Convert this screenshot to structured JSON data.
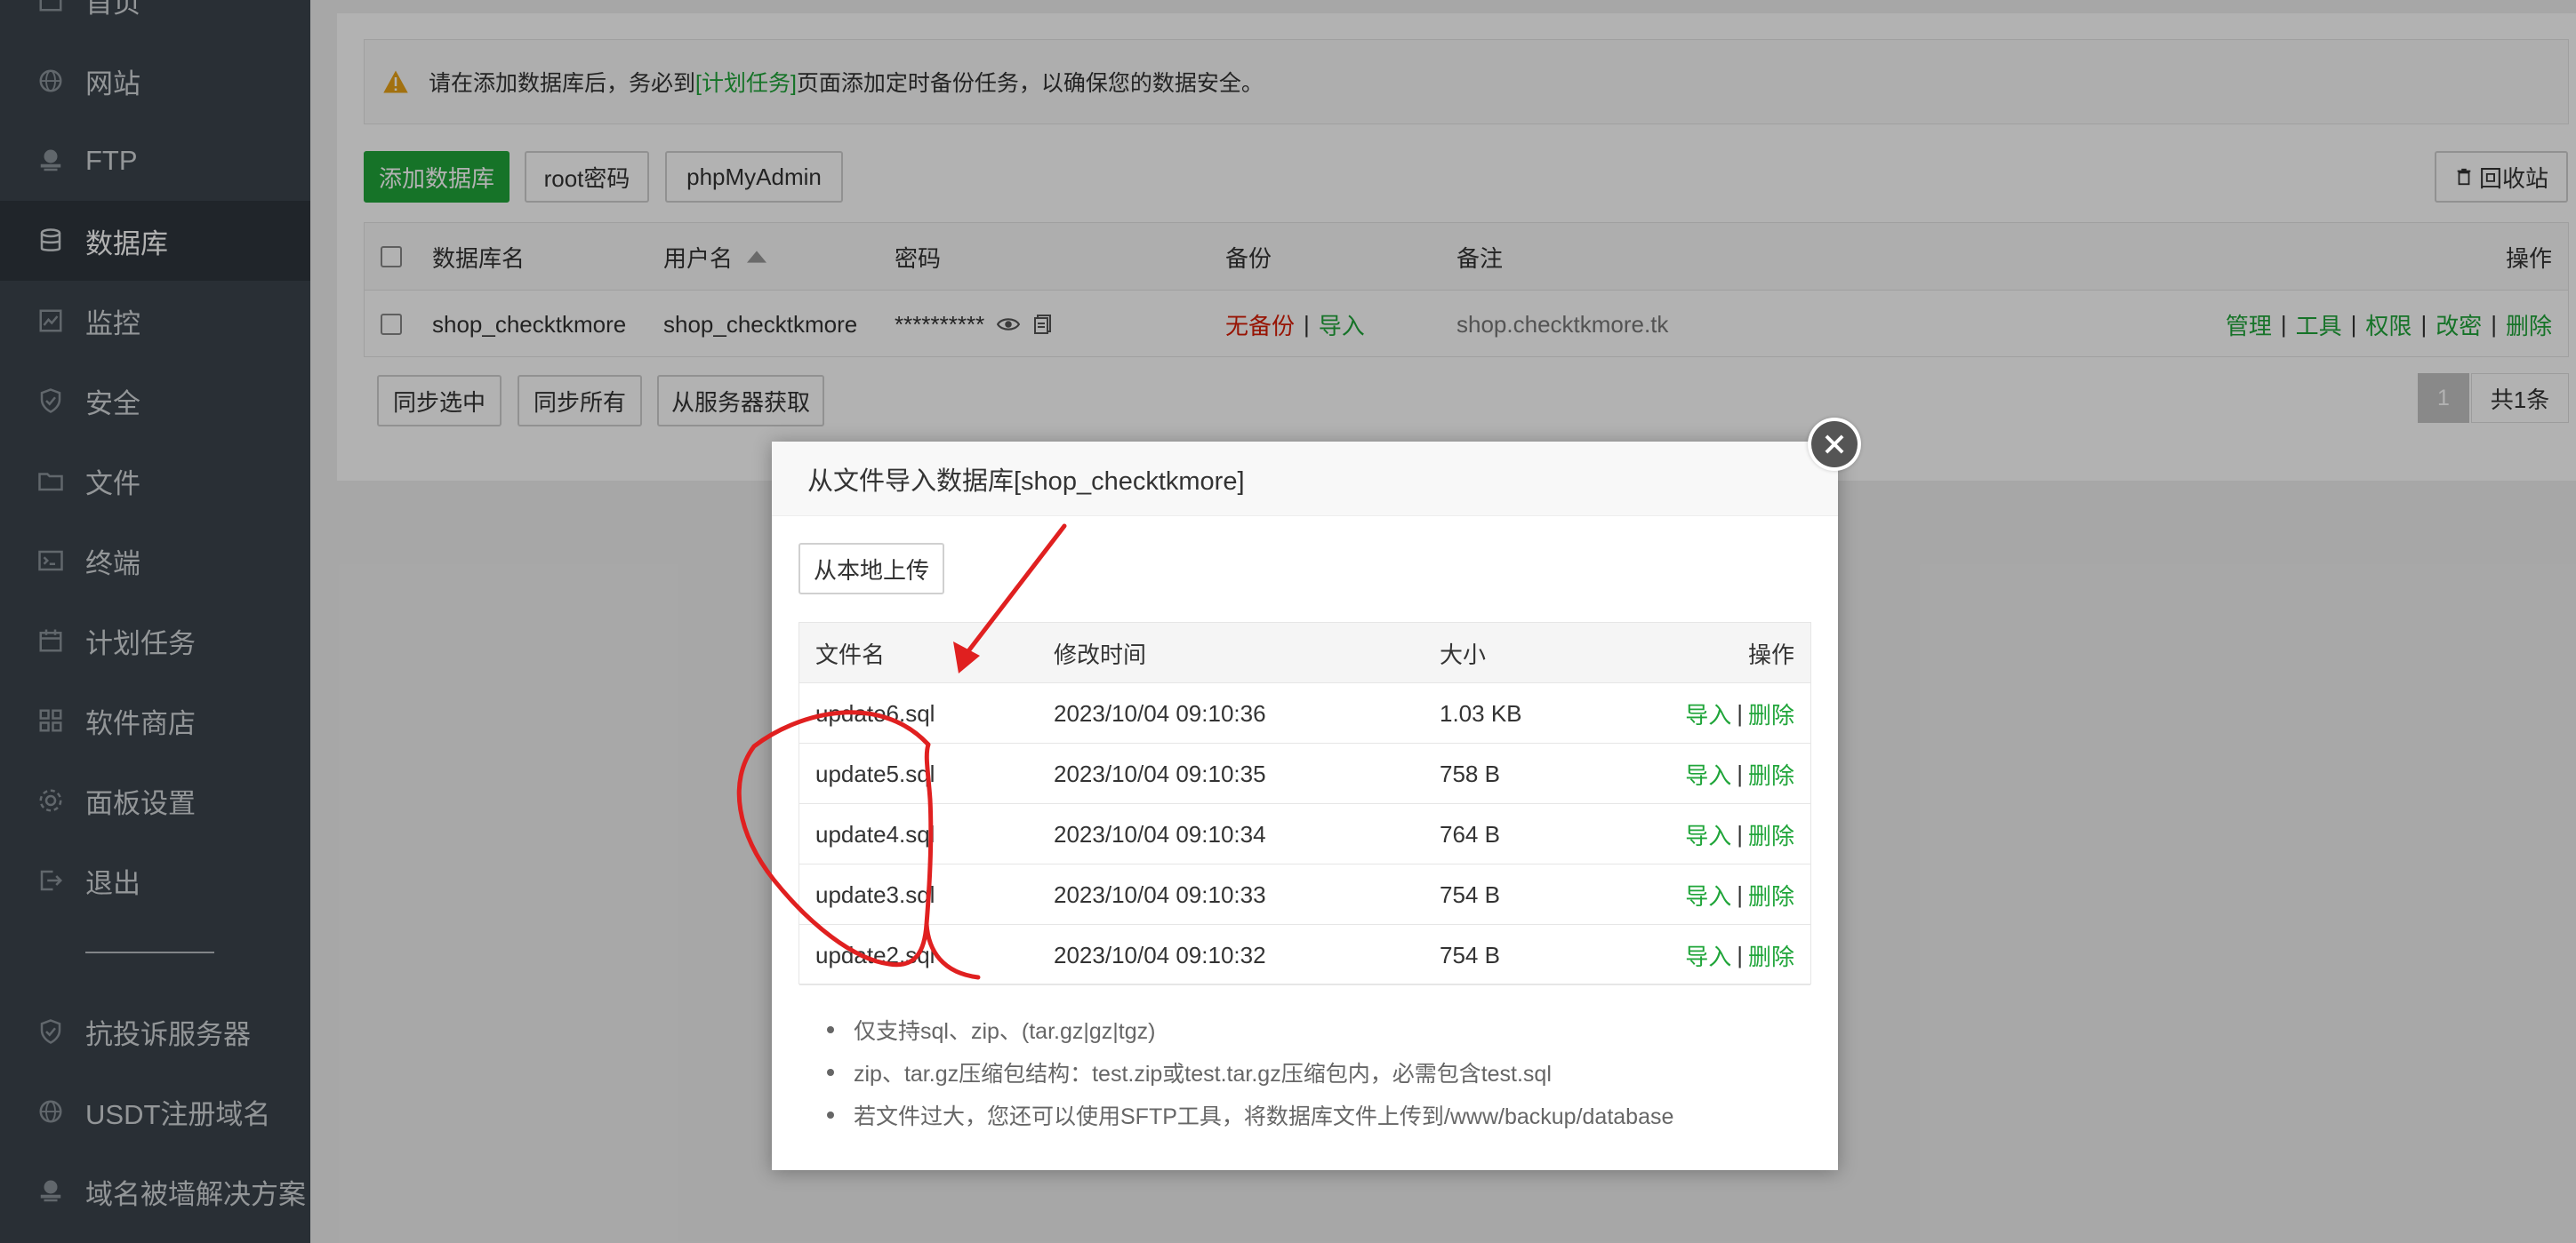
{
  "sidebar": {
    "items": [
      {
        "label": "首页",
        "icon": "home-icon"
      },
      {
        "label": "网站",
        "icon": "globe-icon"
      },
      {
        "label": "FTP",
        "icon": "ftp-icon"
      },
      {
        "label": "数据库",
        "icon": "database-icon",
        "active": true
      },
      {
        "label": "监控",
        "icon": "monitor-icon"
      },
      {
        "label": "安全",
        "icon": "shield-icon"
      },
      {
        "label": "文件",
        "icon": "folder-icon"
      },
      {
        "label": "终端",
        "icon": "terminal-icon"
      },
      {
        "label": "计划任务",
        "icon": "calendar-icon"
      },
      {
        "label": "软件商店",
        "icon": "apps-icon"
      },
      {
        "label": "面板设置",
        "icon": "settings-icon"
      },
      {
        "label": "退出",
        "icon": "logout-icon"
      }
    ],
    "extra_items": [
      {
        "label": "抗投诉服务器",
        "icon": "shield-icon"
      },
      {
        "label": "USDT注册域名",
        "icon": "globe-icon"
      },
      {
        "label": "域名被墙解决方案",
        "icon": "ftp-icon"
      }
    ]
  },
  "notice": {
    "before": "请在添加数据库后，务必到",
    "link": "[计划任务]",
    "after": "页面添加定时备份任务，以确保您的数据安全。"
  },
  "toolbar": {
    "add_db": "添加数据库",
    "root_pwd": "root密码",
    "phpmyadmin": "phpMyAdmin",
    "recycle": "回收站"
  },
  "db_table": {
    "headers": {
      "name": "数据库名",
      "user": "用户名",
      "password": "密码",
      "backup": "备份",
      "note": "备注",
      "ops": "操作"
    },
    "rows": [
      {
        "name": "shop_checktkmore",
        "user": "shop_checktkmore",
        "password": "**********",
        "backup_status": "无备份",
        "backup_import": "导入",
        "note": "shop.checktkmore.tk",
        "ops": [
          "管理",
          "工具",
          "权限",
          "改密",
          "删除"
        ]
      }
    ]
  },
  "bottom_buttons": {
    "sync_selected": "同步选中",
    "sync_all": "同步所有",
    "fetch_server": "从服务器获取"
  },
  "pager": {
    "page": "1",
    "total": "共1条"
  },
  "modal": {
    "title": "从文件导入数据库[shop_checktkmore]",
    "upload": "从本地上传",
    "headers": {
      "file": "文件名",
      "mtime": "修改时间",
      "size": "大小",
      "ops": "操作"
    },
    "files": [
      {
        "name": "update6.sql",
        "mtime": "2023/10/04 09:10:36",
        "size": "1.03 KB"
      },
      {
        "name": "update5.sql",
        "mtime": "2023/10/04 09:10:35",
        "size": "758 B"
      },
      {
        "name": "update4.sql",
        "mtime": "2023/10/04 09:10:34",
        "size": "764 B"
      },
      {
        "name": "update3.sql",
        "mtime": "2023/10/04 09:10:33",
        "size": "754 B"
      },
      {
        "name": "update2.sql",
        "mtime": "2023/10/04 09:10:32",
        "size": "754 B"
      }
    ],
    "op_import": "导入",
    "op_delete": "删除",
    "op_sep": "|",
    "tips": [
      "仅支持sql、zip、(tar.gz|gz|tgz)",
      "zip、tar.gz压缩包结构：test.zip或test.tar.gz压缩包内，必需包含test.sql",
      "若文件过大，您还可以使用SFTP工具，将数据库文件上传到/www/backup/database"
    ]
  },
  "colors": {
    "accent": "#20a53a",
    "danger": "#d81e06",
    "sidebar_bg": "#3c444d",
    "annotation": "#e02020"
  }
}
